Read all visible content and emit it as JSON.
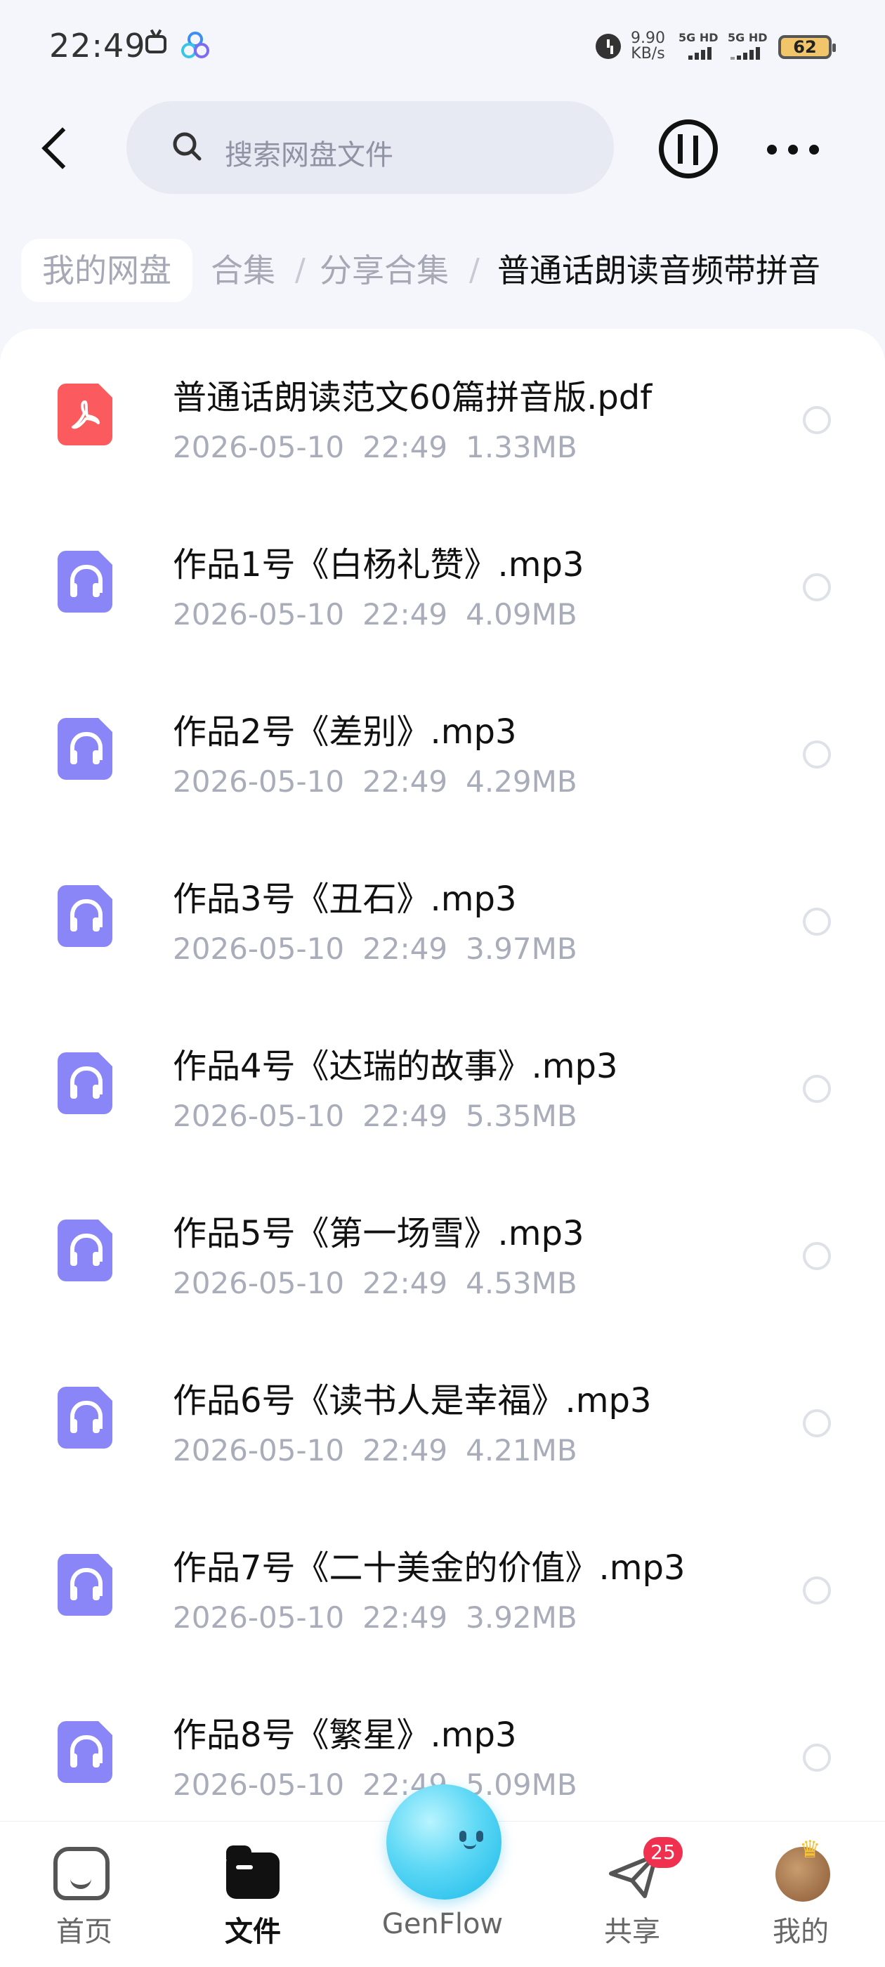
{
  "status_bar": {
    "time": "22:49",
    "net_speed_value": "9.90",
    "net_speed_unit": "KB/s",
    "sim1": "5G HD",
    "sim2": "5G HD",
    "battery": "62"
  },
  "header": {
    "search_placeholder": "搜索网盘文件"
  },
  "breadcrumb": {
    "root": "我的网盘",
    "partial": "合集",
    "separator": "/",
    "middle": "分享合集",
    "current": "普通话朗读音频带拼音"
  },
  "files": [
    {
      "name": "普通话朗读范文60篇拼音版.pdf",
      "date": "2026-05-10",
      "time": "22:49",
      "size": "1.33MB",
      "type": "pdf"
    },
    {
      "name": "作品1号《白杨礼赞》.mp3",
      "date": "2026-05-10",
      "time": "22:49",
      "size": "4.09MB",
      "type": "audio"
    },
    {
      "name": "作品2号《差别》.mp3",
      "date": "2026-05-10",
      "time": "22:49",
      "size": "4.29MB",
      "type": "audio"
    },
    {
      "name": "作品3号《丑石》.mp3",
      "date": "2026-05-10",
      "time": "22:49",
      "size": "3.97MB",
      "type": "audio"
    },
    {
      "name": "作品4号《达瑞的故事》.mp3",
      "date": "2026-05-10",
      "time": "22:49",
      "size": "5.35MB",
      "type": "audio"
    },
    {
      "name": "作品5号《第一场雪》.mp3",
      "date": "2026-05-10",
      "time": "22:49",
      "size": "4.53MB",
      "type": "audio"
    },
    {
      "name": "作品6号《读书人是幸福》.mp3",
      "date": "2026-05-10",
      "time": "22:49",
      "size": "4.21MB",
      "type": "audio"
    },
    {
      "name": "作品7号《二十美金的价值》.mp3",
      "date": "2026-05-10",
      "time": "22:49",
      "size": "3.92MB",
      "type": "audio"
    },
    {
      "name": "作品8号《繁星》.mp3",
      "date": "2026-05-10",
      "time": "22:49",
      "size": "5.09MB",
      "type": "audio"
    }
  ],
  "tabbar": {
    "home": "首页",
    "files": "文件",
    "genflow": "GenFlow",
    "share": "共享",
    "share_badge": "25",
    "mine": "我的"
  },
  "colors": {
    "pdf_icon": "#fb5b5f",
    "audio_icon": "#8a86f7",
    "badge": "#f0304f",
    "genflow": "#19b8ea"
  }
}
